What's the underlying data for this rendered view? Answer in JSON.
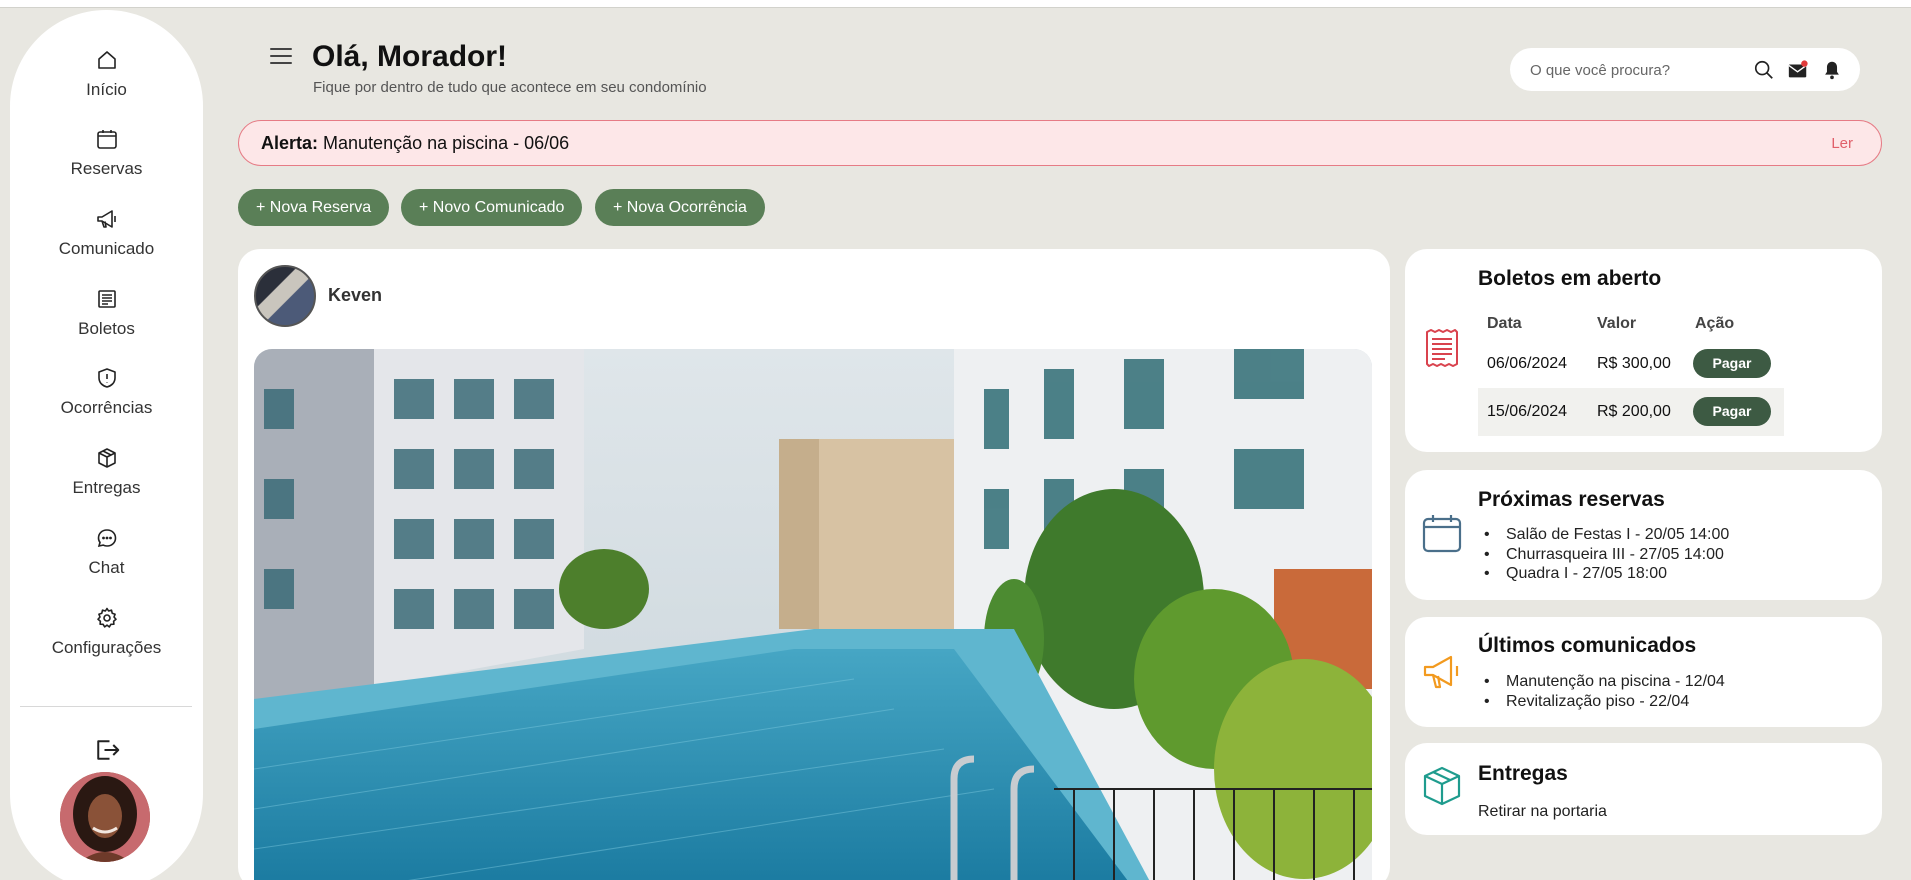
{
  "sidebar": {
    "items": [
      {
        "label": "Início",
        "icon": "home-icon"
      },
      {
        "label": "Reservas",
        "icon": "calendar-icon"
      },
      {
        "label": "Comunicado",
        "icon": "megaphone-icon"
      },
      {
        "label": "Boletos",
        "icon": "receipt-icon"
      },
      {
        "label": "Ocorrências",
        "icon": "shield-alert-icon"
      },
      {
        "label": "Entregas",
        "icon": "package-icon"
      },
      {
        "label": "Chat",
        "icon": "chat-icon"
      },
      {
        "label": "Configurações",
        "icon": "gear-icon"
      }
    ],
    "logout_icon": "logout-icon"
  },
  "header": {
    "title": "Olá, Morador!",
    "subtitle": "Fique por dentro de tudo que acontece em seu condomínio",
    "search_placeholder": "O que você procura?"
  },
  "alert": {
    "label": "Alerta:",
    "message": "Manutenção na piscina - 06/06",
    "action": "Ler"
  },
  "actions": [
    "+ Nova Reserva",
    "+ Novo Comunicado",
    "+ Nova Ocorrência"
  ],
  "feed": {
    "author": "Keven"
  },
  "boletos": {
    "title": "Boletos em aberto",
    "columns": [
      "Data",
      "Valor",
      "Ação"
    ],
    "rows": [
      {
        "date": "06/06/2024",
        "value": "R$ 300,00",
        "action": "Pagar"
      },
      {
        "date": "15/06/2024",
        "value": "R$ 200,00",
        "action": "Pagar"
      }
    ]
  },
  "reservas": {
    "title": "Próximas reservas",
    "items": [
      "Salão de Festas I - 20/05 14:00",
      "Churrasqueira III - 27/05 14:00",
      "Quadra I - 27/05 18:00"
    ]
  },
  "comunicados": {
    "title": "Últimos comunicados",
    "items": [
      "Manutenção na piscina - 12/04",
      "Revitalização piso - 22/04"
    ]
  },
  "entregas": {
    "title": "Entregas",
    "subtitle": "Retirar na portaria"
  },
  "colors": {
    "background": "#e8e7e1",
    "button_green": "#5a7f57",
    "pay_button": "#3d5a43",
    "alert_bg": "#fde7e8",
    "alert_border": "#e67b85",
    "boletos_icon": "#d9434e",
    "reservas_icon": "#4a6f8a",
    "comunicados_icon": "#f29a1f",
    "entregas_icon": "#1f9c8e"
  }
}
